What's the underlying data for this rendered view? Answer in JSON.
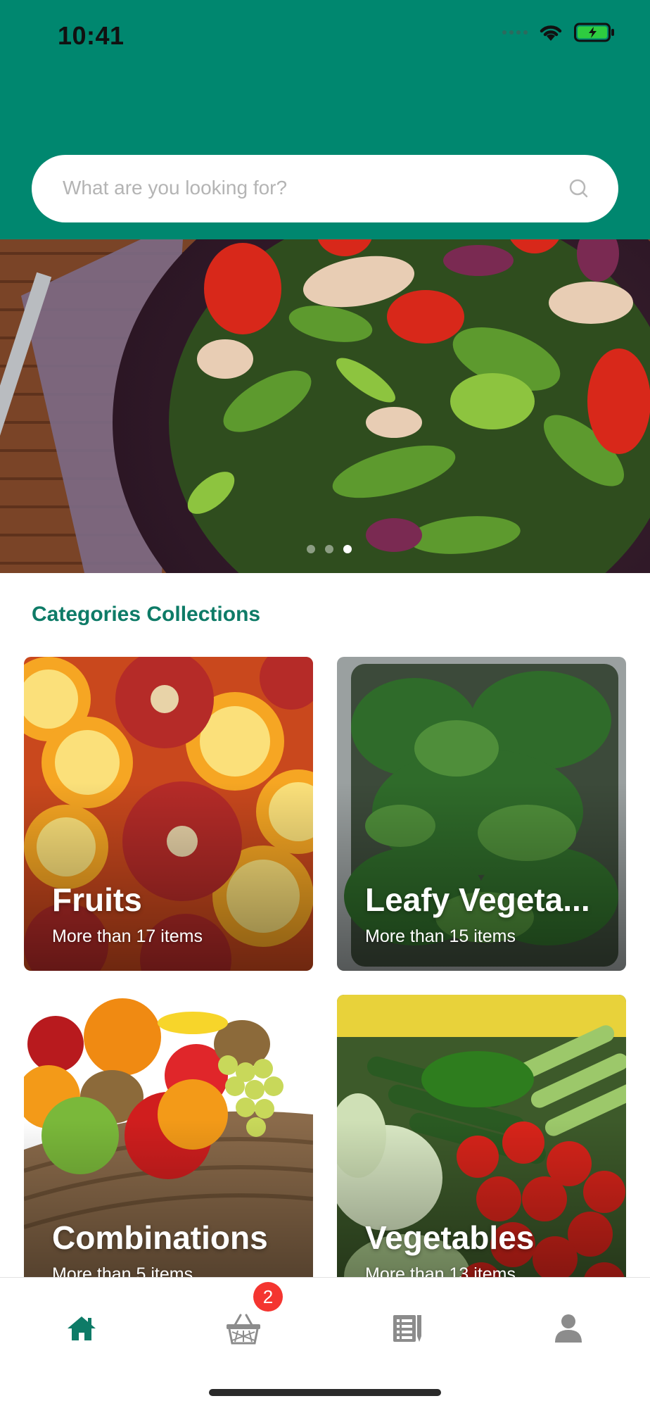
{
  "status_bar": {
    "time": "10:41"
  },
  "search": {
    "placeholder": "What are you looking for?"
  },
  "hero": {
    "slide_count": 3,
    "active_slide": 3
  },
  "section": {
    "title": "Categories Collections"
  },
  "categories": [
    {
      "name": "Fruits",
      "subtitle": "More than 17 items"
    },
    {
      "name": "Leafy Vegeta...",
      "subtitle": "More than 15 items"
    },
    {
      "name": "Combinations",
      "subtitle": "More than 5 items"
    },
    {
      "name": "Vegetables",
      "subtitle": "More than 13 items"
    }
  ],
  "tabbar": {
    "tabs": [
      {
        "icon": "home-icon",
        "active": true
      },
      {
        "icon": "basket-icon",
        "badge": "2"
      },
      {
        "icon": "menu-book-icon"
      },
      {
        "icon": "profile-icon"
      }
    ]
  },
  "colors": {
    "brand": "#00876f",
    "accent_text": "#0e7b67",
    "badge": "#f43530",
    "inactive_icon": "#8c8c8c"
  }
}
